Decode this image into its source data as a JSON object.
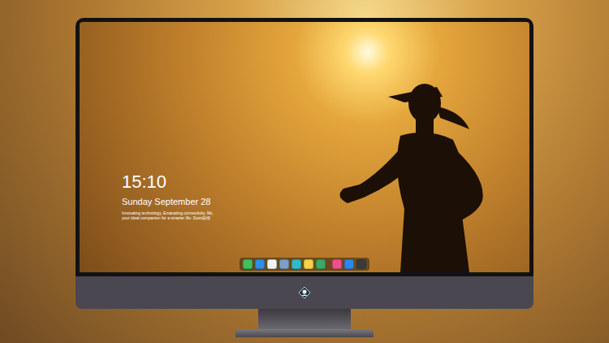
{
  "lock_screen": {
    "time": "15:10",
    "date": "Sunday September 28",
    "tagline": [
      "Innovating technology, Emanating connectivity. Mx,",
      "your ideal companion for a smarter life. Soon就绪"
    ]
  },
  "dock": {
    "groups": [
      [
        {
          "color": "#3fc25a"
        },
        {
          "color": "#2f8fe8"
        },
        {
          "color": "#f2f2f2"
        },
        {
          "color": "#7aa0c8"
        },
        {
          "color": "#35b8c8"
        },
        {
          "color": "#f5d24a"
        },
        {
          "color": "#3aa866"
        }
      ],
      [
        {
          "color": "#f0508a"
        },
        {
          "color": "#2f86f0"
        },
        {
          "color": "#3a3a3e"
        }
      ]
    ]
  }
}
